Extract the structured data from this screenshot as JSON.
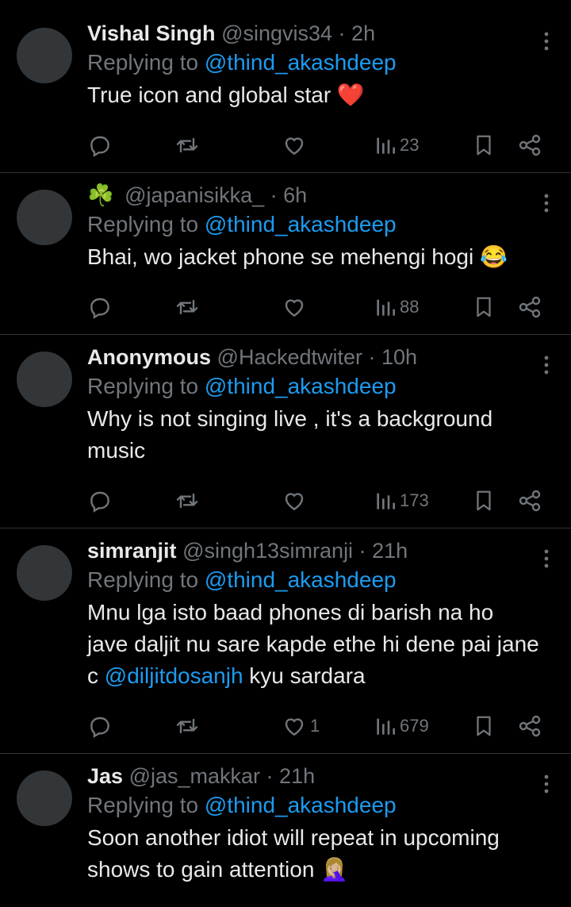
{
  "replies": [
    {
      "name": "Vishal Singh",
      "handle": "@singvis34",
      "time": "2h",
      "replying_prefix": "Replying to ",
      "replying_to": "@thind_akashdeep",
      "text": "True icon and global star",
      "text_emoji": "❤️",
      "likes": "",
      "views": "23"
    },
    {
      "name": "☘️",
      "handle": "@japanisikka_",
      "time": "6h",
      "replying_prefix": "Replying to ",
      "replying_to": "@thind_akashdeep",
      "text": "Bhai, wo jacket phone se mehengi hogi",
      "text_emoji": "😂",
      "likes": "",
      "views": "88"
    },
    {
      "name": "Anonymous",
      "handle": "@Hackedtwiter",
      "time": "10h",
      "replying_prefix": "Replying to ",
      "replying_to": "@thind_akashdeep",
      "text": "Why is not singing live , it's a background music",
      "text_emoji": "",
      "likes": "",
      "views": "173"
    },
    {
      "name": "simranjit",
      "handle": "@singh13simranji",
      "time": "21h",
      "replying_prefix": "Replying to ",
      "replying_to": "@thind_akashdeep",
      "text_before": "Mnu lga isto baad phones di barish na ho jave daljit nu sare kapde ethe hi dene pai jane c ",
      "text_mention": "@diljitdosanjh",
      "text_after": " kyu sardara",
      "likes": "1",
      "views": "679"
    },
    {
      "name": "Jas",
      "handle": "@jas_makkar",
      "time": "21h",
      "replying_prefix": "Replying to ",
      "replying_to": "@thind_akashdeep",
      "text": "Soon another idiot will repeat in upcoming shows to gain attention",
      "text_emoji": "🤦🏼‍♀️",
      "likes": "",
      "views": ""
    }
  ],
  "separator": " · ",
  "icons": [
    "reply-icon",
    "retweet-icon",
    "like-icon",
    "views-icon",
    "bookmark-icon",
    "share-icon",
    "more-icon"
  ],
  "colors": {
    "background": "#000000",
    "text": "#e7e9ea",
    "muted": "#71767b",
    "link": "#1d9bf0"
  }
}
